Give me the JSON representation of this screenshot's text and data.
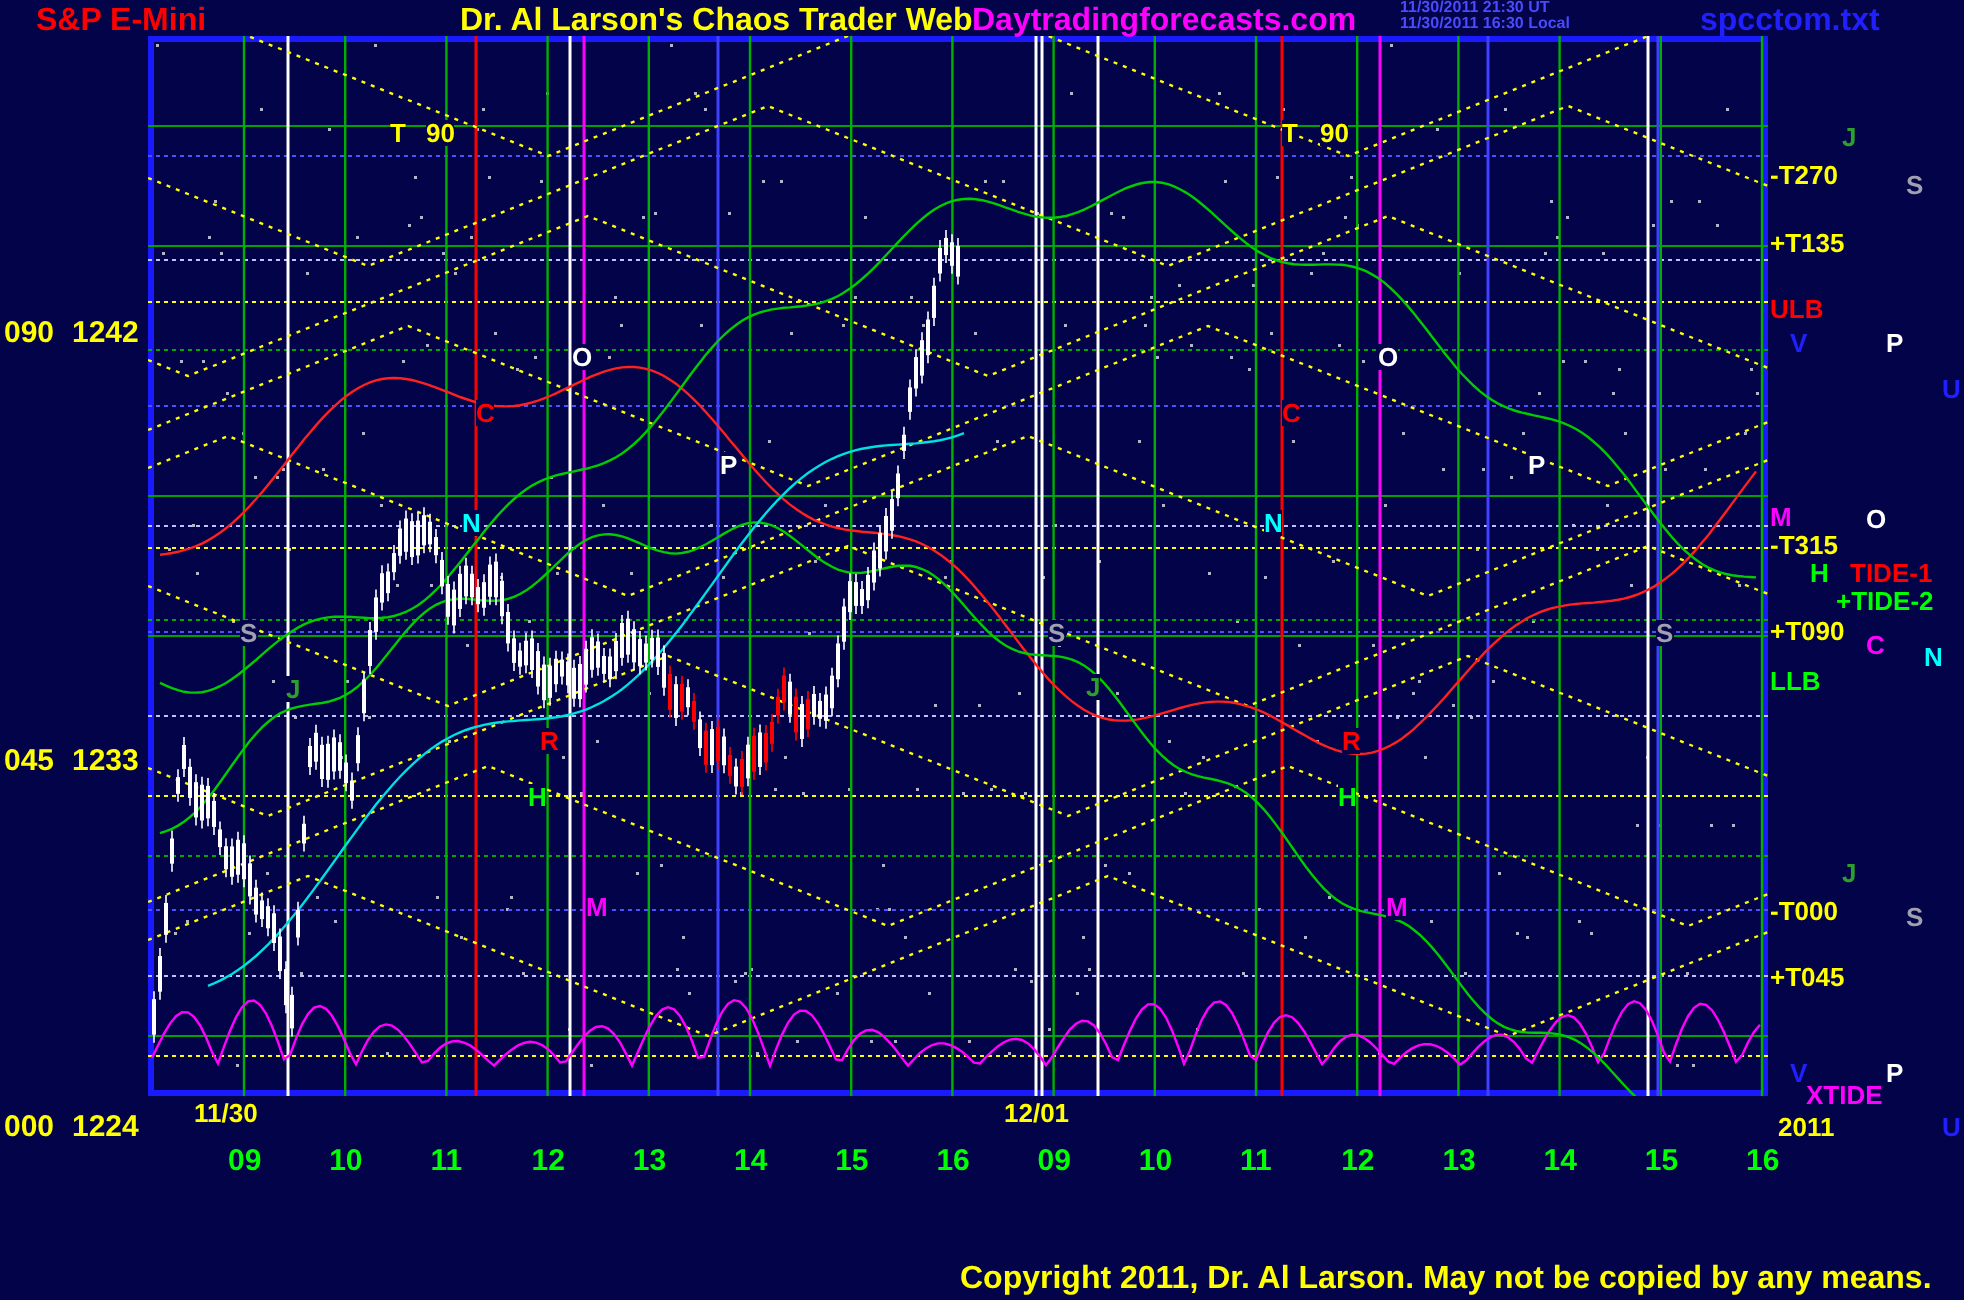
{
  "header": {
    "market": "S&P E-Mini",
    "title": "Dr. Al Larson's Chaos Trader Web",
    "site": "Daytradingforecasts.com",
    "timestamps": [
      "11/30/2011 21:30 UT",
      "11/30/2011 16:30 Local"
    ],
    "file": "spcctom.txt"
  },
  "chart": {
    "inner_labels": [
      {
        "text": "T",
        "color": "#ffff00"
      },
      {
        "text": "90",
        "color": "#ffff00"
      },
      {
        "text": "T",
        "color": "#ffff00"
      },
      {
        "text": "90",
        "color": "#ffff00"
      },
      {
        "text": "O",
        "color": "#ffffff"
      },
      {
        "text": "O",
        "color": "#ffffff"
      },
      {
        "text": "C",
        "color": "#ff0000"
      },
      {
        "text": "C",
        "color": "#ff0000"
      },
      {
        "text": "P",
        "color": "#ffffff"
      },
      {
        "text": "P",
        "color": "#ffffff"
      },
      {
        "text": "N",
        "color": "#00ffff"
      },
      {
        "text": "N",
        "color": "#00ffff"
      },
      {
        "text": "S",
        "color": "#a0a0b0"
      },
      {
        "text": "S",
        "color": "#a0a0b0"
      },
      {
        "text": "S",
        "color": "#a0a0b0"
      },
      {
        "text": "J",
        "color": "#2e9e2e"
      },
      {
        "text": "J",
        "color": "#2e9e2e"
      },
      {
        "text": "R",
        "color": "#ff0000"
      },
      {
        "text": "R",
        "color": "#ff0000"
      },
      {
        "text": "H",
        "color": "#00ff00"
      },
      {
        "text": "H",
        "color": "#00ff00"
      },
      {
        "text": "M",
        "color": "#ff00ff"
      },
      {
        "text": "M",
        "color": "#ff00ff"
      },
      {
        "text": "11/30",
        "color": "#ffff00"
      },
      {
        "text": "12/01",
        "color": "#ffff00"
      }
    ],
    "y_labels": [
      {
        "angle": "090",
        "price": "1242"
      },
      {
        "angle": "045",
        "price": "1233"
      },
      {
        "angle": "000",
        "price": "1224"
      }
    ],
    "x_labels": [
      "09",
      "10",
      "11",
      "12",
      "13",
      "14",
      "15",
      "16",
      "09",
      "10",
      "11",
      "12",
      "13",
      "14",
      "15",
      "16"
    ],
    "right_labels": [
      {
        "text": "J",
        "color": "#2e9e2e"
      },
      {
        "text": "-T270",
        "color": "#ffff00"
      },
      {
        "text": "S",
        "color": "#a0a0b0"
      },
      {
        "text": "+T135",
        "color": "#ffff00"
      },
      {
        "text": "ULB",
        "color": "#ff0000"
      },
      {
        "text": "V",
        "color": "#2020ff"
      },
      {
        "text": "P",
        "color": "#ffffff"
      },
      {
        "text": "U",
        "color": "#2020ff"
      },
      {
        "text": "M",
        "color": "#ff00ff"
      },
      {
        "text": "O",
        "color": "#ffffff"
      },
      {
        "text": "-T315",
        "color": "#ffff00"
      },
      {
        "text": "H",
        "color": "#00ff00"
      },
      {
        "text": "TIDE-1",
        "color": "#ff0000"
      },
      {
        "text": "+TIDE-2",
        "color": "#00ff00"
      },
      {
        "text": "+T090",
        "color": "#ffff00"
      },
      {
        "text": "C",
        "color": "#ff00ff"
      },
      {
        "text": "N",
        "color": "#00ffff"
      },
      {
        "text": "LLB",
        "color": "#00ff00"
      },
      {
        "text": "J",
        "color": "#2e9e2e"
      },
      {
        "text": "-T000",
        "color": "#ffff00"
      },
      {
        "text": "S",
        "color": "#a0a0b0"
      },
      {
        "text": "+T045",
        "color": "#ffff00"
      },
      {
        "text": "V",
        "color": "#2020ff"
      },
      {
        "text": "P",
        "color": "#ffffff"
      },
      {
        "text": "XTIDE",
        "color": "#ff00ff"
      },
      {
        "text": "2011",
        "color": "#ffff00"
      },
      {
        "text": "U",
        "color": "#2020ff"
      }
    ]
  },
  "copyright": "Copyright 2011, Dr. Al Larson. May not be copied by any means."
}
